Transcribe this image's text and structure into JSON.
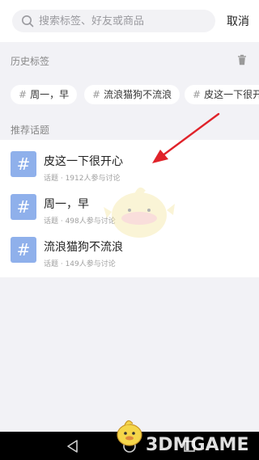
{
  "search": {
    "placeholder": "搜索标签、好友或商品",
    "value": "",
    "cancel_label": "取消"
  },
  "history": {
    "header": "历史标签",
    "tags": [
      "周一，早",
      "流浪猫狗不流浪",
      "皮这一下很开心"
    ]
  },
  "recommend": {
    "header": "推荐话题",
    "topics": [
      {
        "title": "皮这一下很开心",
        "meta": "话题 · 1912人参与讨论"
      },
      {
        "title": "周一，早",
        "meta": "话题 · 498人参与讨论"
      },
      {
        "title": "流浪猫狗不流浪",
        "meta": "话题 · 149人参与讨论"
      }
    ]
  },
  "icons": {
    "search": "search-icon",
    "trash": "trash-icon",
    "hash": "hash-icon",
    "back": "back-triangle-icon",
    "home": "home-circle-icon",
    "recent": "recent-square-icon"
  },
  "colors": {
    "topic_icon_bg": "#8fb0eb",
    "annotation_arrow": "#e0232a",
    "page_bg": "#f2f2f6"
  },
  "watermark": {
    "text": "3DMGAME"
  }
}
